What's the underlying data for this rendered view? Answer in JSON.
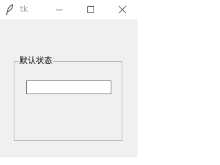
{
  "window": {
    "title": "tk",
    "icon": "feather-icon",
    "controls": {
      "minimize": "minimize-icon",
      "maximize": "maximize-icon",
      "close": "close-icon"
    }
  },
  "labelframe": {
    "title": "默认状态"
  },
  "entry": {
    "value": ""
  },
  "colors": {
    "background": "#f0f0f0",
    "titlebar": "#ffffff",
    "frame_border": "#b5b5b5",
    "entry_border": "#7a7a7a"
  }
}
